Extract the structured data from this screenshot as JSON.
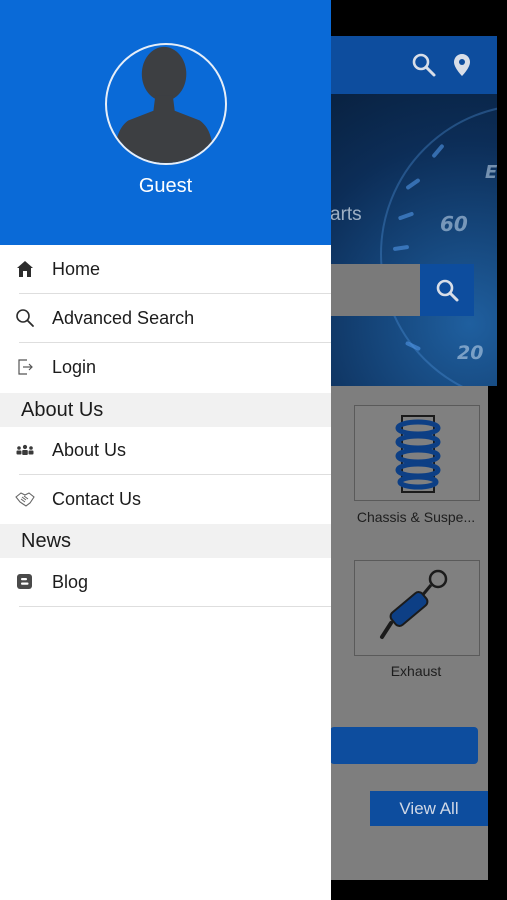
{
  "background": {
    "hero_text": "arts",
    "gauge_numbers": [
      "60",
      "20",
      "E"
    ],
    "card_chassis": "Chassis & Suspe...",
    "card_exhaust": "Exhaust",
    "view_all": "View All"
  },
  "drawer": {
    "user_name": "Guest",
    "items_top": [
      {
        "label": "Home",
        "icon": "home-icon"
      },
      {
        "label": "Advanced Search",
        "icon": "search-icon"
      },
      {
        "label": "Login",
        "icon": "login-icon"
      }
    ],
    "section_about": "About Us",
    "items_about": [
      {
        "label": "About Us",
        "icon": "people-icon"
      },
      {
        "label": "Contact Us",
        "icon": "handshake-icon"
      }
    ],
    "section_news": "News",
    "items_news": [
      {
        "label": "Blog",
        "icon": "blogger-icon"
      }
    ]
  },
  "colors": {
    "drawer_header": "#0a6ad7",
    "app_blue": "#0d4d9e"
  }
}
